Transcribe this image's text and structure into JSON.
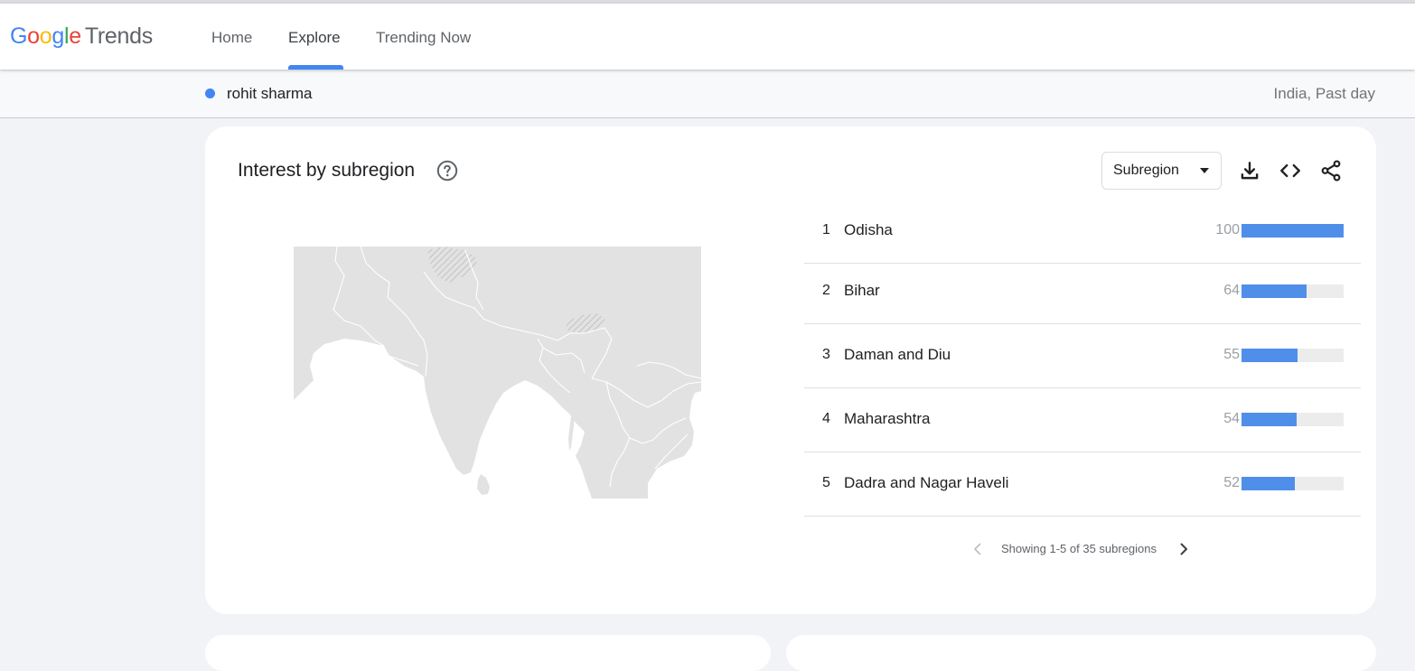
{
  "app": {
    "logo_google": [
      "G",
      "o",
      "o",
      "g",
      "l",
      "e"
    ],
    "logo_product": "Trends"
  },
  "nav": [
    {
      "label": "Home",
      "active": false
    },
    {
      "label": "Explore",
      "active": true
    },
    {
      "label": "Trending Now",
      "active": false
    }
  ],
  "term": {
    "label": "rohit sharma",
    "color": "#4285f4",
    "meta": "India, Past day"
  },
  "card": {
    "title": "Interest by subregion",
    "resolution": "Subregion",
    "icons": [
      "help-icon",
      "download-icon",
      "embed-icon",
      "share-icon"
    ]
  },
  "regions": [
    {
      "rank": "1",
      "name": "Odisha",
      "score": 100
    },
    {
      "rank": "2",
      "name": "Bihar",
      "score": 64
    },
    {
      "rank": "3",
      "name": "Daman and Diu",
      "score": 55
    },
    {
      "rank": "4",
      "name": "Maharashtra",
      "score": 54
    },
    {
      "rank": "5",
      "name": "Dadra and Nagar Haveli",
      "score": 52
    }
  ],
  "pager": {
    "text": "Showing 1-5 of 35 subregions"
  },
  "colors": {
    "bar": "#4f8fe9",
    "bar_track": "#ececec",
    "accent": "#4285f4"
  }
}
